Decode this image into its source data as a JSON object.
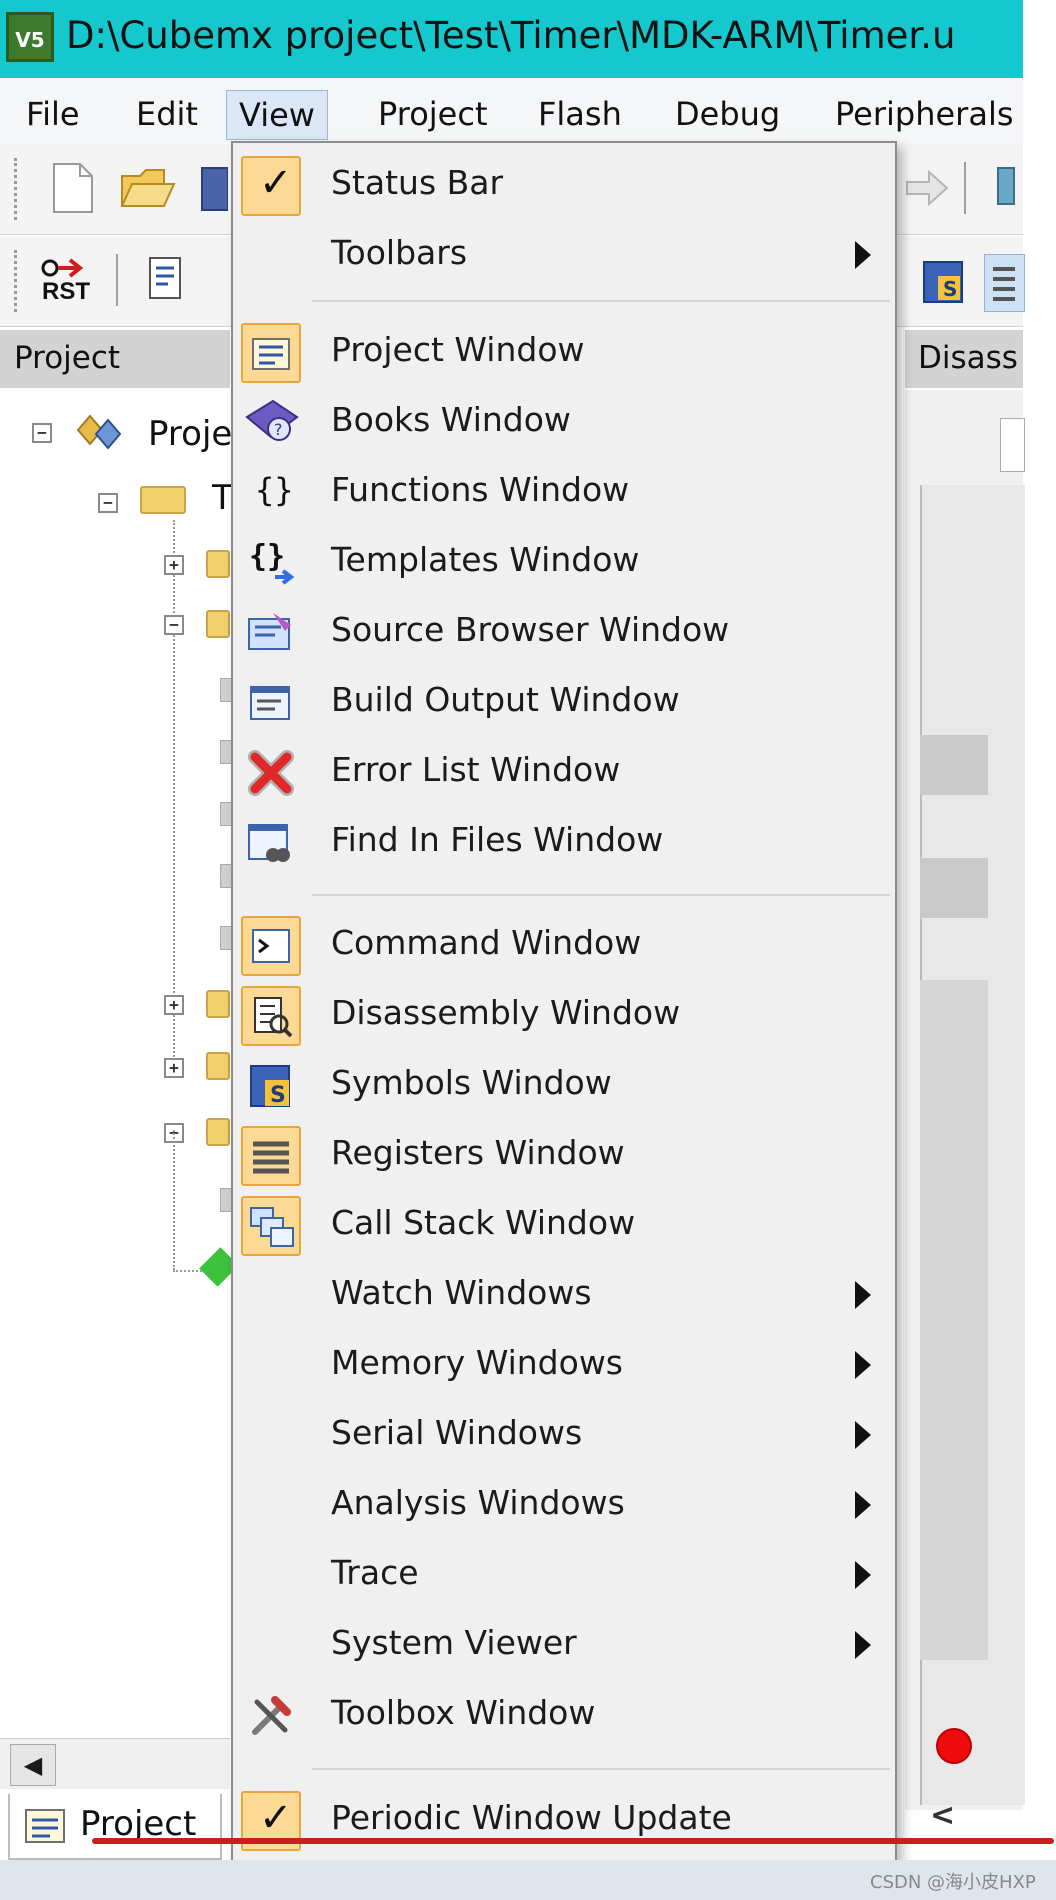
{
  "title_bar": {
    "icon": "uvision-icon",
    "text": "D:\\Cubemx project\\Test\\Timer\\MDK-ARM\\Timer.u"
  },
  "menubar": [
    "File",
    "Edit",
    "View",
    "Project",
    "Flash",
    "Debug",
    "Peripherals"
  ],
  "panes": {
    "project_header": "Project",
    "disassembly_header": "Disass",
    "tree_root": "Proje",
    "tree_child_letter": "T",
    "project_tab": "Project",
    "scroll_left": "◀"
  },
  "view_menu": {
    "items": [
      {
        "label": "Status Bar",
        "icon": "checkmark-icon",
        "checked": true
      },
      {
        "label": "Toolbars",
        "submenu": true
      },
      {
        "label": "Project Window",
        "icon": "project-window-icon"
      },
      {
        "label": "Books Window",
        "icon": "books-icon"
      },
      {
        "label": "Functions Window",
        "icon": "braces-icon"
      },
      {
        "label": "Templates Window",
        "icon": "templates-icon"
      },
      {
        "label": "Source Browser Window",
        "icon": "source-browser-icon"
      },
      {
        "label": "Build Output Window",
        "icon": "build-output-icon"
      },
      {
        "label": "Error List Window",
        "icon": "error-x-icon"
      },
      {
        "label": "Find In Files Window",
        "icon": "find-in-files-icon"
      },
      {
        "label": "Command Window",
        "icon": "command-prompt-icon"
      },
      {
        "label": "Disassembly Window",
        "icon": "disassembly-icon"
      },
      {
        "label": "Symbols Window",
        "icon": "symbols-icon"
      },
      {
        "label": "Registers Window",
        "icon": "registers-icon"
      },
      {
        "label": "Call Stack Window",
        "icon": "call-stack-icon"
      },
      {
        "label": "Watch Windows",
        "submenu": true
      },
      {
        "label": "Memory Windows",
        "submenu": true
      },
      {
        "label": "Serial Windows",
        "submenu": true
      },
      {
        "label": "Analysis Windows",
        "submenu": true
      },
      {
        "label": "Trace",
        "submenu": true
      },
      {
        "label": "System Viewer",
        "submenu": true
      },
      {
        "label": "Toolbox Window",
        "icon": "toolbox-icon"
      },
      {
        "label": "Periodic Window Update",
        "icon": "checkmark-icon",
        "checked": true
      }
    ]
  },
  "toolbar2_label": "RST",
  "watermark": "CSDN @海小皮HXP",
  "colors": {
    "title_bar": "#14c8cd",
    "menu_bg": "#f0f0f0",
    "icon_frame": "#fcd994",
    "underline": "#c81e1e"
  }
}
